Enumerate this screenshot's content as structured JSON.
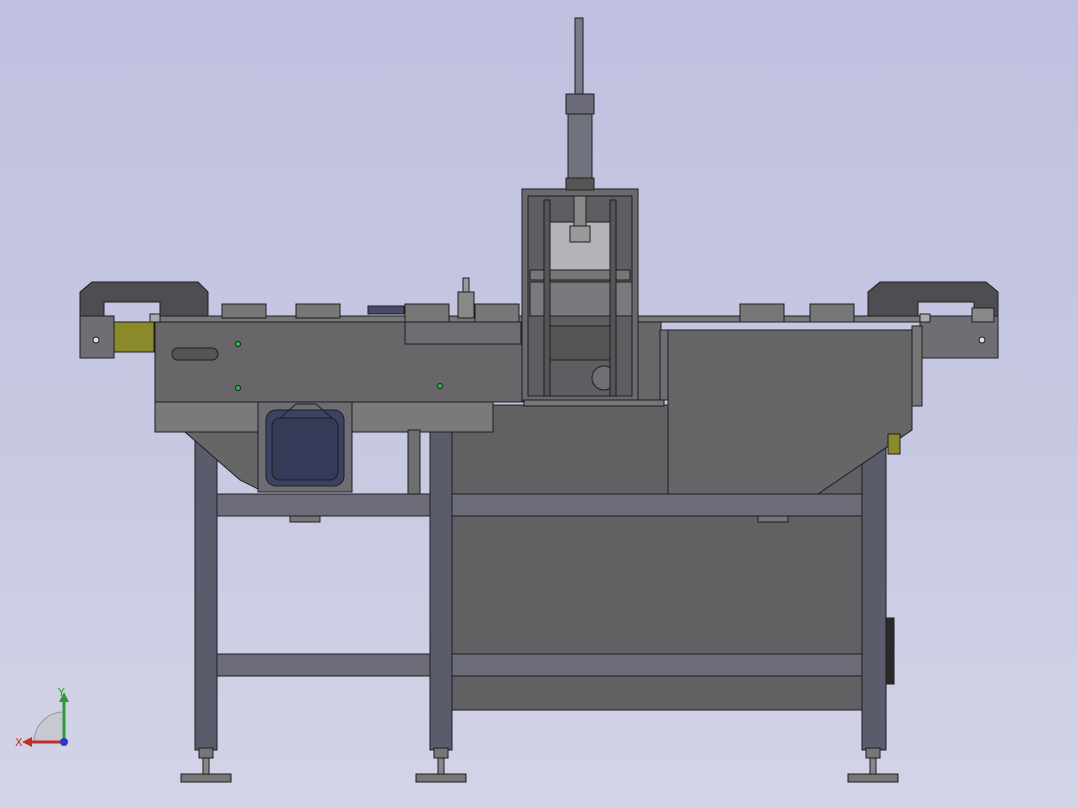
{
  "viewport": {
    "background_top": "#bfc0e0",
    "background_bottom": "#d3d4e6"
  },
  "model": {
    "frame_color": "#5a5b60",
    "panel_color": "#636366",
    "leg_color": "#585968",
    "motor_color": "#3c4263",
    "accent_color": "#8a8a2a",
    "edge_color": "#1e1e22"
  },
  "triad": {
    "x_label": "X",
    "y_label": "Y",
    "x_color": "#c0302a",
    "y_color": "#2f9a3a",
    "z_color": "#2c3cc0"
  }
}
